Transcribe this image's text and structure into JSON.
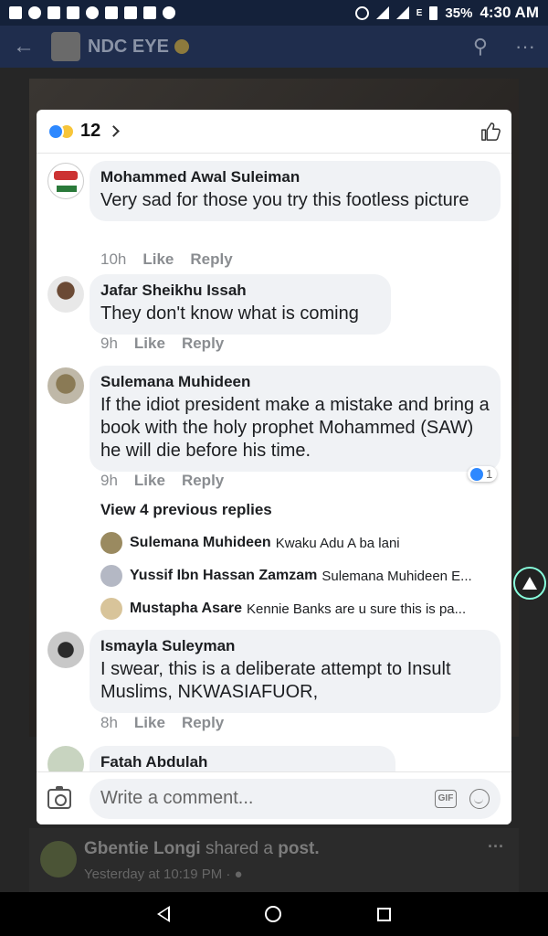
{
  "status_bar": {
    "battery": "35%",
    "time": "4:30 AM",
    "network": "E"
  },
  "app_bar": {
    "page_name": "NDC EYE"
  },
  "background_post": {
    "author": "Gbentie Longi",
    "action": "shared a",
    "object": "post.",
    "time": "Yesterday at 10:19 PM ·"
  },
  "modal": {
    "reaction_count": "12",
    "comments": [
      {
        "author": "Mohammed Awal Suleiman",
        "text": "Very sad for those you try this footless picture",
        "time": "10h",
        "like": "Like",
        "reply": "Reply"
      },
      {
        "author": "Jafar Sheikhu Issah",
        "text": "They don't know what is coming",
        "time": "9h",
        "like": "Like",
        "reply": "Reply"
      },
      {
        "author": "Sulemana Muhideen",
        "text": "If  the idiot president make a  mistake and bring a book with the holy prophet Mohammed (SAW) he will die before his time.",
        "time": "9h",
        "like": "Like",
        "reply": "Reply",
        "like_count": "1"
      },
      {
        "author": "Ismayla Suleyman",
        "text": "I swear, this is a deliberate attempt to Insult Muslims, NKWASIAFUOR,",
        "time": "8h",
        "like": "Like",
        "reply": "Reply"
      },
      {
        "author": "Fatah Abdulah"
      }
    ],
    "view_replies": "View 4 previous replies",
    "replies": [
      {
        "author": "Sulemana Muhideen",
        "text": "Kwaku Adu A ba lani"
      },
      {
        "author": "Yussif Ibn Hassan Zamzam",
        "text": "Sulemana Muhideen E..."
      },
      {
        "author": "Mustapha Asare",
        "text": "Kennie Banks are u sure this is pa..."
      }
    ],
    "composer": {
      "placeholder": "Write a comment...",
      "gif": "GIF"
    }
  },
  "colors": {
    "like_blue": "#2d88ff",
    "bubble_bg": "#f0f2f5",
    "header_navy": "#1f2d4d"
  }
}
